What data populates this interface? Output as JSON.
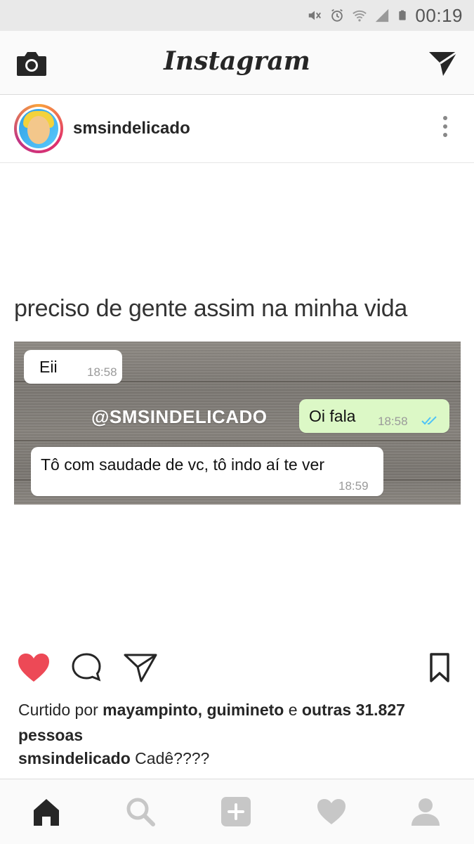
{
  "status_bar": {
    "time": "00:19",
    "icons": [
      "mute-icon",
      "alarm-icon",
      "wifi-icon",
      "signal-icon",
      "battery-icon"
    ]
  },
  "app_bar": {
    "title": "Instagram",
    "left_icon": "camera-icon",
    "right_icon": "direct-message-icon"
  },
  "post": {
    "username": "smsindelicado",
    "image": {
      "headline": "preciso de gente assim na minha vida",
      "watermark": "@SMSINDELICADO",
      "messages": [
        {
          "text": "Eii",
          "time": "18:58",
          "side": "left"
        },
        {
          "text": "Oi fala",
          "time": "18:58",
          "side": "right",
          "read": true
        },
        {
          "text": "Tô com saudade de vc, tô indo aí te ver",
          "time": "18:59",
          "side": "left"
        }
      ]
    },
    "liked": true,
    "likes": {
      "prefix": "Curtido por",
      "user1": "mayampinto",
      "comma": ",",
      "user2": "guimineto",
      "and": "e",
      "others": "outras 31.827 pessoas"
    },
    "caption": {
      "username": "smsindelicado",
      "text": "Cadê????"
    }
  },
  "bottom_nav": [
    "home-icon",
    "search-icon",
    "add-post-icon",
    "activity-heart-icon",
    "profile-icon"
  ],
  "colors": {
    "like_red": "#ed4956",
    "icon_dark": "#262626",
    "nav_inactive": "#c7c7c7",
    "status_bar_bg": "#e9e9e9",
    "outgoing_bubble": "#dcf8c6",
    "read_ticks": "#4fc3f7"
  }
}
